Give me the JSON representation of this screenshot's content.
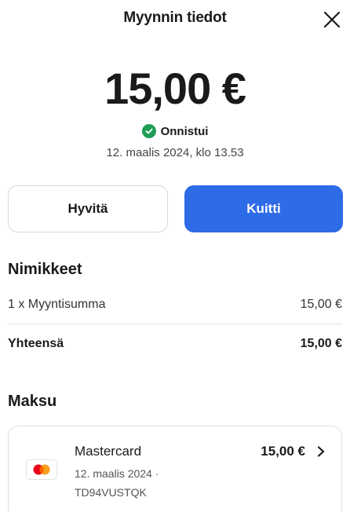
{
  "header": {
    "title": "Myynnin tiedot",
    "close_icon": "close-icon"
  },
  "summary": {
    "amount": "15,00 €",
    "status": "Onnistui",
    "status_icon": "check-circle-icon",
    "status_color": "#1f9d55",
    "timestamp": "12. maalis 2024, klo 13.53"
  },
  "actions": {
    "refund_label": "Hyvitä",
    "receipt_label": "Kuitti",
    "accent_color": "#2e6be6"
  },
  "items": {
    "title": "Nimikkeet",
    "rows": [
      {
        "description": "1 x  Myyntisumma",
        "amount": "15,00 €"
      }
    ],
    "total_label": "Yhteensä",
    "total_amount": "15,00 €"
  },
  "payment": {
    "title": "Maksu",
    "card_brand": "Mastercard",
    "card_icon": "mastercard-icon",
    "amount": "15,00 €",
    "date": "12. maalis 2024 ·",
    "reference": "TD94VUSTQK",
    "chevron_icon": "chevron-right-icon"
  }
}
